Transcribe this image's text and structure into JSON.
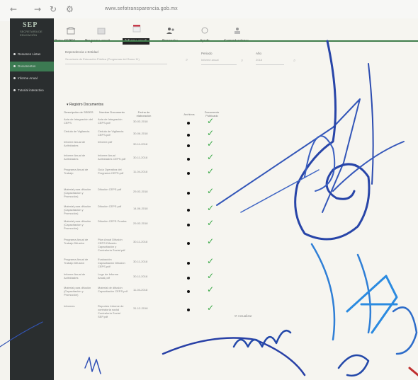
{
  "browser": {
    "url": "www.sefotransparencia.gob.mx",
    "back_icon": "arrow-left-icon",
    "forward_icon": "arrow-right-icon",
    "reload_icon": "reload-icon",
    "settings_icon": "gear-icon"
  },
  "brand": {
    "name": "SEP",
    "subtitle": "SECRETARÍA DE EDUCACIÓN"
  },
  "sidebar": {
    "items": [
      {
        "label": "Resumen Listas"
      },
      {
        "label": "Documentos"
      },
      {
        "label": "Informe Anual"
      },
      {
        "label": "Tutorial interactivo"
      }
    ],
    "active_index": 1
  },
  "toolbar": {
    "items": [
      {
        "label": "Datos SEDES",
        "icon": "building-icon"
      },
      {
        "label": "Programa anual",
        "icon": "folder-icon"
      },
      {
        "label": "Informe anual",
        "icon": "document-icon"
      },
      {
        "label": "Denuncias",
        "icon": "people-icon"
      },
      {
        "label": "Ayuda",
        "icon": "help-icon"
      },
      {
        "label": "Comunicaciones",
        "icon": "megaphone-icon"
      }
    ],
    "active_index": 2
  },
  "filters": {
    "entity_label": "Dependencia o Entidad",
    "entity_value": "Secretaría de Educación Pública (Programas del Ramo 11)",
    "period_label": "Periodo",
    "period_value": "Informe anual",
    "year_label": "Año",
    "year_value": "2018"
  },
  "section": {
    "title": "Registro Documentos"
  },
  "table": {
    "headers": [
      "Descripción de SEDES",
      "Nombre Documento",
      "Fecha de elaboración",
      "Archivos",
      "Documento Publicado"
    ],
    "rows": [
      [
        "Acta de Integración del CEPS",
        "Acta de Integración CEPS.pdf",
        "30-03-2018"
      ],
      [
        "Cédula de Vigilancia",
        "Cédula de Vigilancia CEPS.pdf",
        "30-06-2018"
      ],
      [
        "Informe Anual de Actividades",
        "Informe.pdf",
        "30-11-2018"
      ],
      [
        "Informe Anual de Actividades",
        "Informe Anual Actividades CEPS.pdf",
        "30-11-2018"
      ],
      [
        "Programa Anual de Trabajo",
        "Guía Operativa del Programa CEPS.pdf",
        "11-04-2018"
      ],
      [
        "Material para difusión (Capacitación y Promoción)",
        "Difusión CEPS.pdf",
        "29-03-2018"
      ],
      [
        "Material para difusión (Capacitación y Promoción)",
        "Difusión CEPS.pdf",
        "14-06-2018"
      ],
      [
        "Material para difusión (Capacitación y Promoción)",
        "Difusión CEPS Prueba",
        "29-03-2018"
      ],
      [
        "Programa Anual de Trabajo Difusión",
        "Plan Anual Difusión CEPS Difusión Capacitación y Contraloría Social.pdf",
        "30-11-2018"
      ],
      [
        "Programa Anual de Trabajo Difusión",
        "Evaluación Capacitación Difusión CEPS.pdf",
        "30-11-2018"
      ],
      [
        "Informe Anual de Actividades",
        "Logo de Informe Anual.pdf",
        "30-11-2018"
      ],
      [
        "Material para difusión (Capacitación y Promoción)",
        "Material de difusión Capacitación CEPS.pdf",
        "11-04-2018"
      ],
      [
        "Informes",
        "Reportes Informe de contraloría social Contraloría Social SEP.pdf",
        "31-12-2018"
      ]
    ]
  },
  "footer": {
    "label": "Actualizar"
  },
  "colors": {
    "sidebar_bg": "#2a2e2f",
    "active_green": "#3c7a52",
    "check_green": "#3daa4a",
    "ink_blue": "#2f4fb5"
  }
}
